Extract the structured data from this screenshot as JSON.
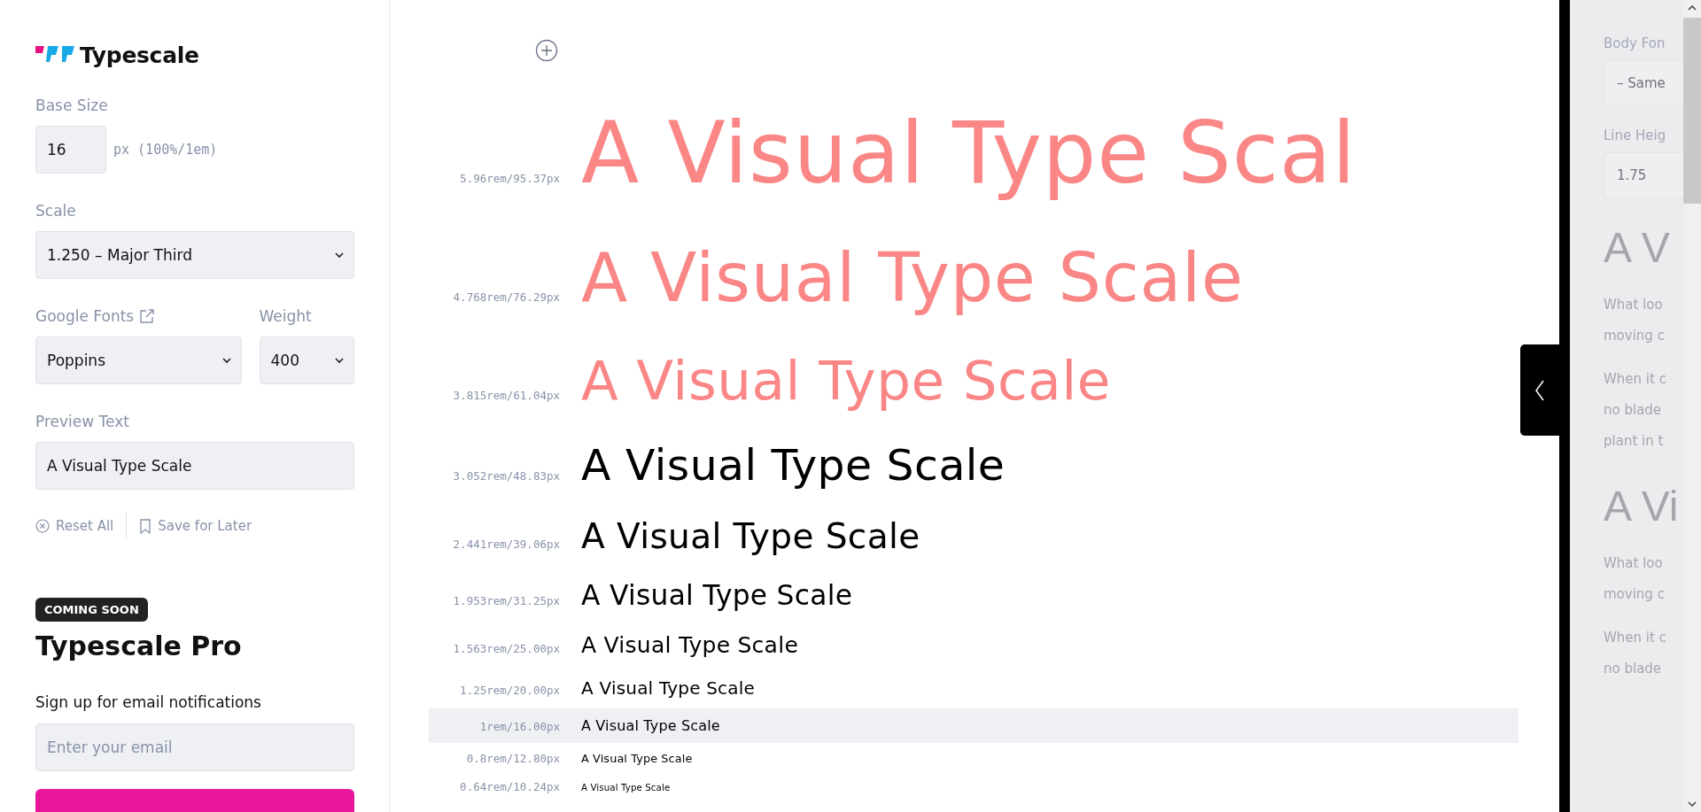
{
  "sidebar": {
    "logo": {
      "title": "Typescale"
    },
    "base_size": {
      "label": "Base Size",
      "value": "16",
      "unit": "px (100%/1em)"
    },
    "scale": {
      "label": "Scale",
      "value": "1.250 – Major Third"
    },
    "google_fonts": {
      "label": "Google Fonts",
      "value": "Poppins"
    },
    "weight": {
      "label": "Weight",
      "value": "400"
    },
    "preview_text": {
      "label": "Preview Text",
      "value": "A Visual Type Scale"
    },
    "actions": [
      {
        "kind": "reset",
        "label": "Reset All"
      },
      {
        "kind": "save",
        "label": "Save for Later"
      }
    ],
    "promo": {
      "badge": "COMING SOON",
      "title": "Typescale Pro",
      "text": "Sign up for email notifications",
      "email_placeholder": "Enter your email"
    }
  },
  "preview": {
    "rows": [
      {
        "label": "5.96rem/95.37px",
        "text": "A Visual Type Scal",
        "color": "#fa8686",
        "selected": false
      },
      {
        "label": "4.768rem/76.29px",
        "text": "A Visual Type Scale",
        "color": "#fa8686",
        "selected": false
      },
      {
        "label": "3.815rem/61.04px",
        "text": "A Visual Type Scale",
        "color": "#fa8686",
        "selected": false
      },
      {
        "label": "3.052rem/48.83px",
        "text": "A Visual Type Scale",
        "color": "#000000",
        "selected": false
      },
      {
        "label": "2.441rem/39.06px",
        "text": "A Visual Type Scale",
        "color": "#000000",
        "selected": false
      },
      {
        "label": "1.953rem/31.25px",
        "text": "A Visual Type Scale",
        "color": "#000000",
        "selected": false
      },
      {
        "label": "1.563rem/25.00px",
        "text": "A Visual Type Scale",
        "color": "#000000",
        "selected": false
      },
      {
        "label": "1.25rem/20.00px",
        "text": "A Visual Type Scale",
        "color": "#000000",
        "selected": false
      },
      {
        "label": "1rem/16.00px",
        "text": "A Visual Type Scale",
        "color": "#000000",
        "selected": true
      },
      {
        "label": "0.8rem/12.80px",
        "text": "A Visual Type Scale",
        "color": "#000000",
        "selected": false
      },
      {
        "label": "0.64rem/10.24px",
        "text": "A Visual Type Scale",
        "color": "#000000",
        "selected": false
      }
    ]
  },
  "panel": {
    "body_font": {
      "label": "Body Fon",
      "value": "– Same"
    },
    "line_height": {
      "label": "Line Heig",
      "value": "1.75"
    },
    "samples": [
      {
        "heading": "A V",
        "paragraphs": [
          [
            "What loo",
            "moving c"
          ],
          [
            "When it c",
            "no blade",
            "plant in t"
          ]
        ]
      },
      {
        "heading": "A Vi",
        "paragraphs": [
          [
            "What loo",
            "moving c"
          ],
          [
            "When it c",
            "no blade"
          ]
        ]
      }
    ]
  }
}
